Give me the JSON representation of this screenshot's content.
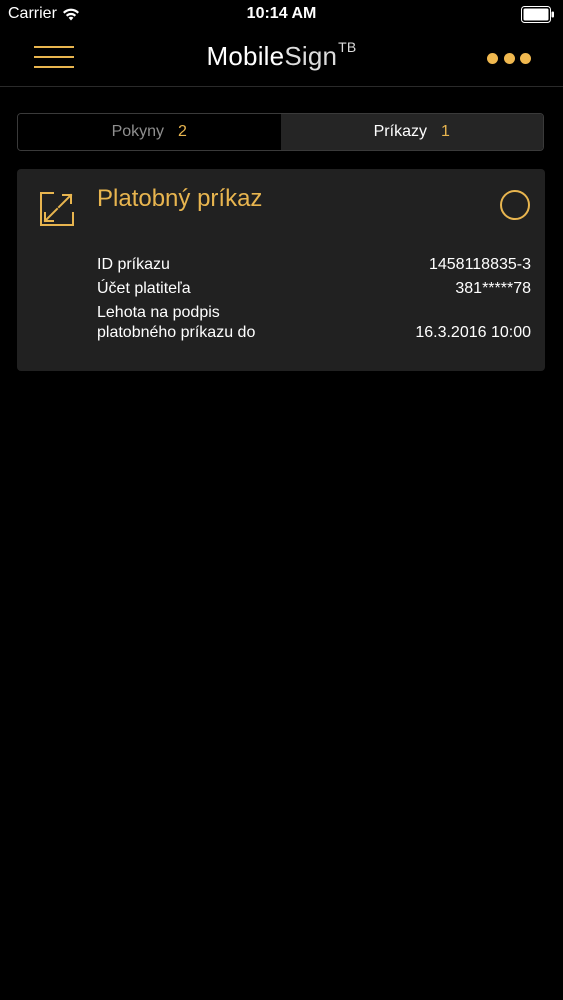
{
  "status_bar": {
    "carrier": "Carrier",
    "time": "10:14 AM"
  },
  "header": {
    "title_main": "Mobile",
    "title_light": "Sign",
    "title_sup": "TB",
    "menu_icon": "hamburger-menu-icon",
    "more_icon": "more-dots-icon"
  },
  "tabs": [
    {
      "label": "Pokyny",
      "count": "2",
      "active": false
    },
    {
      "label": "Príkazy",
      "count": "1",
      "active": true
    }
  ],
  "card": {
    "icon": "transfer-arrows-icon",
    "title": "Platobný príkaz",
    "details": [
      {
        "label": "ID príkazu",
        "value": "1458118835-3"
      },
      {
        "label": "Účet platiteľa",
        "value": "381*****78"
      },
      {
        "label_line1": "Lehota na podpis",
        "label_line2": "platobného príkazu do",
        "value": "16.3.2016 10:00"
      }
    ]
  },
  "colors": {
    "accent": "#e8b54f",
    "background": "#000000",
    "card": "#212121"
  }
}
